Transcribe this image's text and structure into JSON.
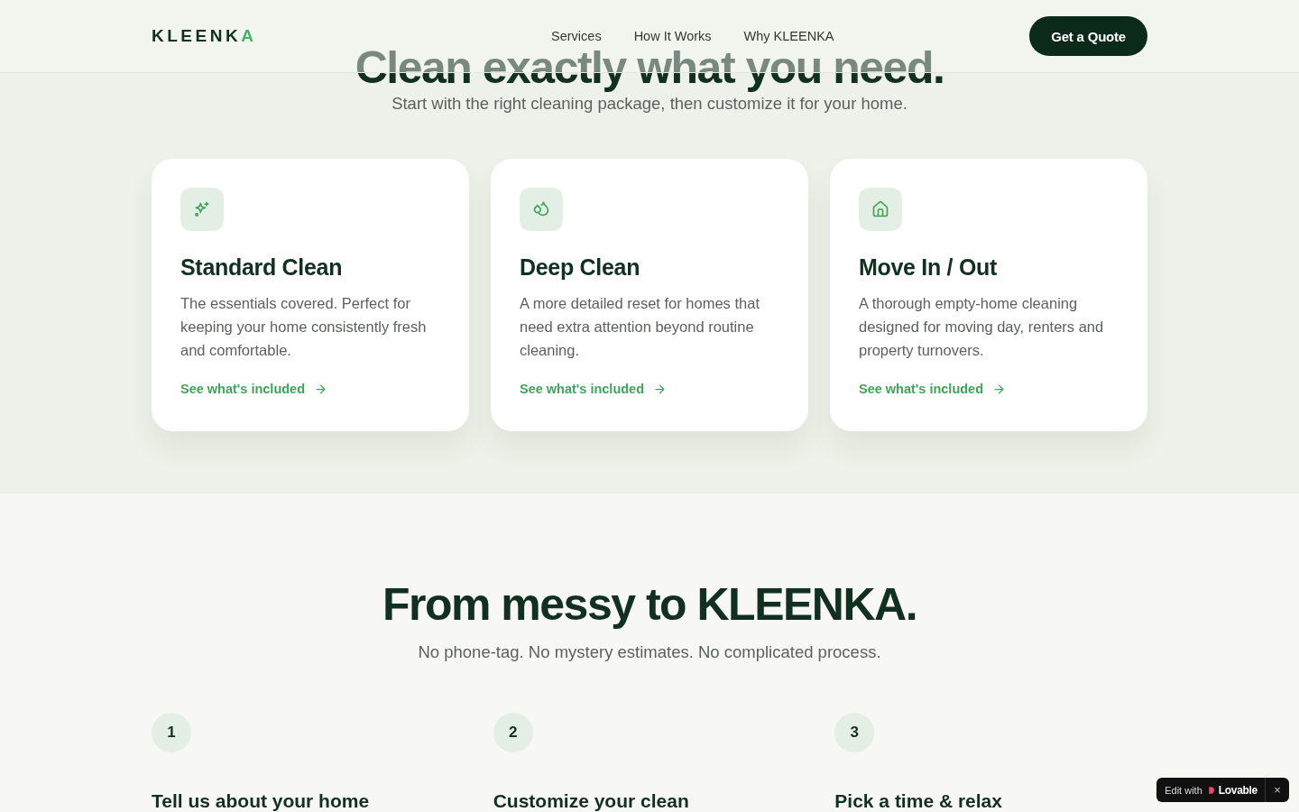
{
  "header": {
    "logo": {
      "main": "KLEENK",
      "accent": "A"
    },
    "nav": [
      {
        "label": "Services"
      },
      {
        "label": "How It Works"
      },
      {
        "label": "Why KLEENKA"
      }
    ],
    "cta": "Get a Quote"
  },
  "services": {
    "title": "Clean exactly what you need.",
    "subtitle": "Start with the right cleaning package, then customize it for your home.",
    "cards": [
      {
        "title": "Standard Clean",
        "text": "The essentials covered. Perfect for keeping your home consistently fresh and comfortable.",
        "link": "See what's included"
      },
      {
        "title": "Deep Clean",
        "text": "A more detailed reset for homes that need extra attention beyond routine cleaning.",
        "link": "See what's included"
      },
      {
        "title": "Move In / Out",
        "text": "A thorough empty-home cleaning designed for moving day, renters and property turnovers.",
        "link": "See what's included"
      }
    ]
  },
  "process": {
    "title": "From messy to KLEENKA.",
    "subtitle": "No phone-tag. No mystery estimates. No complicated process.",
    "steps": [
      {
        "number": "1",
        "title": "Tell us about your home"
      },
      {
        "number": "2",
        "title": "Customize your clean"
      },
      {
        "number": "3",
        "title": "Pick a time & relax"
      }
    ]
  },
  "badge": {
    "label": "Edit with",
    "brand": "Lovable",
    "close": "×"
  }
}
